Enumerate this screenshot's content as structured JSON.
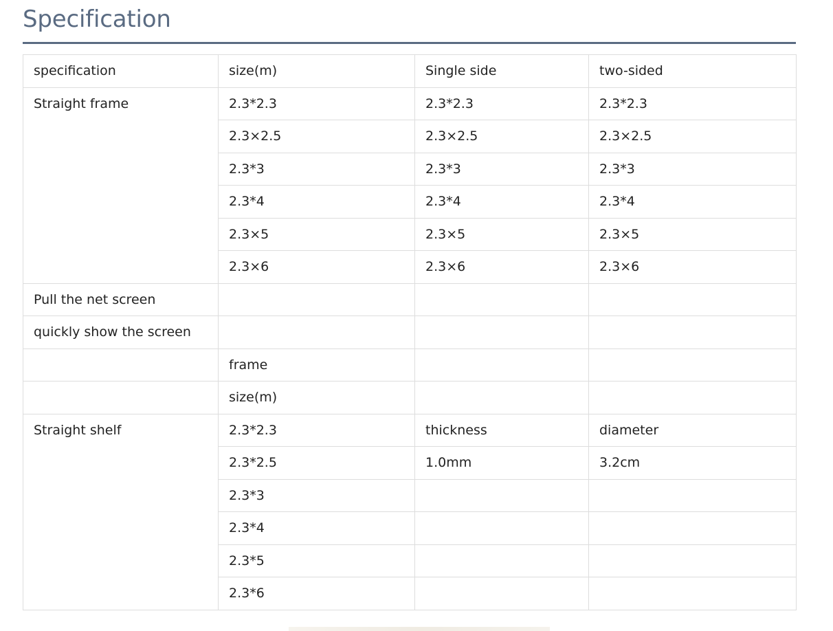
{
  "section": {
    "title": "Specification"
  },
  "table": {
    "header": [
      "specification",
      "size(m)",
      "Single side",
      "two-sided"
    ],
    "straight_frame": {
      "label": "Straight frame",
      "rows": [
        [
          "2.3*2.3",
          "2.3*2.3",
          "2.3*2.3"
        ],
        [
          "2.3×2.5",
          "2.3×2.5",
          "2.3×2.5"
        ],
        [
          "2.3*3",
          "2.3*3",
          "2.3*3"
        ],
        [
          "2.3*4",
          "2.3*4",
          "2.3*4"
        ],
        [
          "2.3×5",
          "2.3×5",
          "2.3×5"
        ],
        [
          "2.3×6",
          "2.3×6",
          "2.3×6"
        ]
      ]
    },
    "pull_net_screen": {
      "label": "Pull the net screen"
    },
    "quick_show_screen": {
      "label": "quickly show the screen"
    },
    "frame_row": {
      "label": "frame"
    },
    "size_row": {
      "label": "size(m)"
    },
    "straight_shelf": {
      "label": "Straight shelf",
      "rows": [
        [
          "2.3*2.3",
          "thickness",
          "diameter"
        ],
        [
          "2.3*2.5",
          "1.0mm",
          "3.2cm"
        ],
        [
          "2.3*3",
          "",
          ""
        ],
        [
          "2.3*4",
          "",
          ""
        ],
        [
          "2.3*5",
          "",
          ""
        ],
        [
          "2.3*6",
          "",
          ""
        ]
      ]
    }
  }
}
